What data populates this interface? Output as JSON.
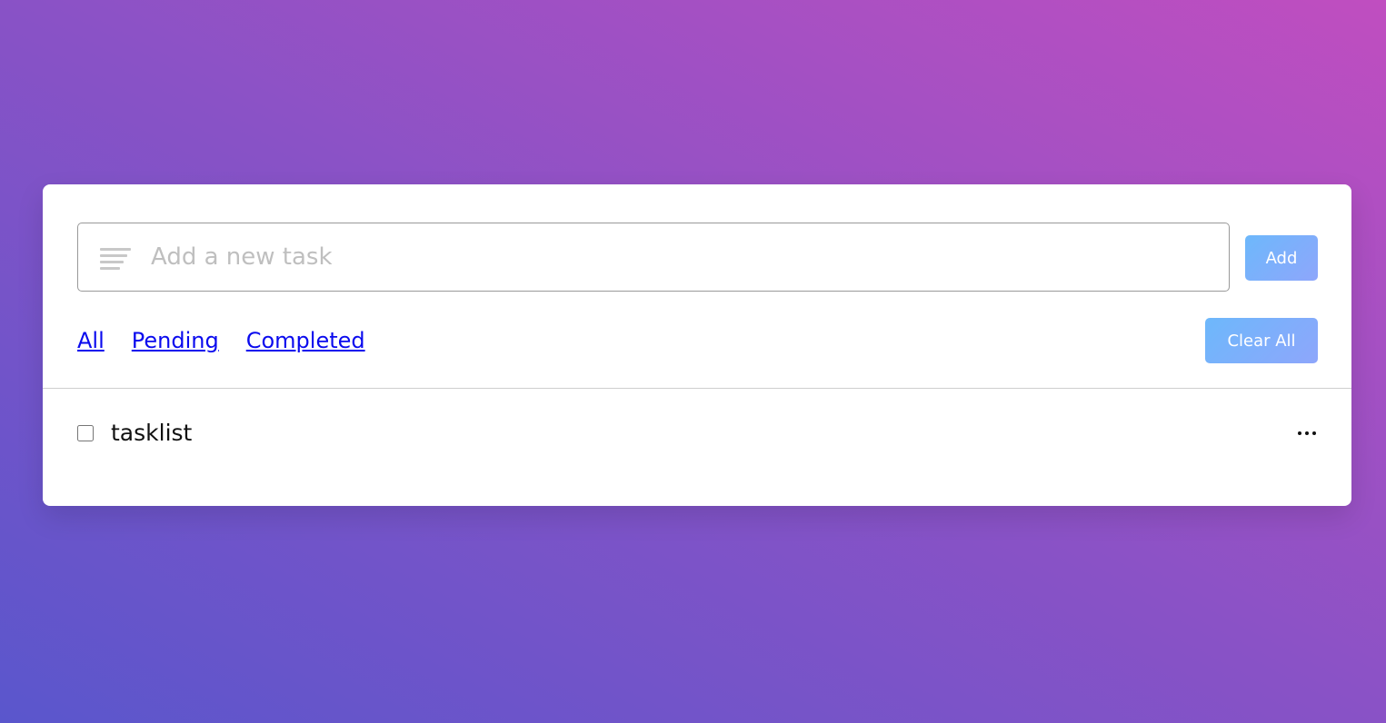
{
  "input": {
    "placeholder": "Add a new task",
    "value": ""
  },
  "toolbar": {
    "add_label": "Add",
    "clear_label": "Clear All"
  },
  "filters": {
    "items": [
      {
        "label": "All"
      },
      {
        "label": "Pending"
      },
      {
        "label": "Completed"
      }
    ]
  },
  "tasks": [
    {
      "name": "tasklist",
      "completed": false
    }
  ],
  "icons": {
    "input_icon": "menu-lines-icon",
    "task_menu": "more-horizontal-icon"
  },
  "colors": {
    "background_start": "#5a56cc",
    "background_end": "#c04ec0",
    "button_start": "#6db8fb",
    "button_end": "#8ea6fb",
    "link": "#0a0aee"
  }
}
